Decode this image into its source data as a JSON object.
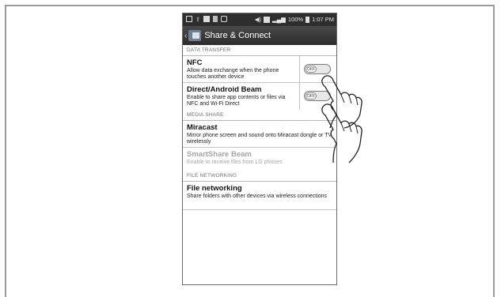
{
  "status_bar": {
    "battery": "100%",
    "time": "1:07 PM",
    "icons": [
      "image-icon",
      "upload-icon",
      "bag-icon",
      "sd-icon",
      "screen-icon",
      "volume-icon",
      "sim-icon",
      "signal-icon",
      "battery-icon"
    ]
  },
  "title_bar": {
    "title": "Share & Connect",
    "back_icon": "chevron-left-icon",
    "app_icon": "share-connect-icon"
  },
  "sections": {
    "data_transfer": "DATA TRANSFER",
    "media_share": "MEDIA SHARE",
    "file_networking": "FILE NETWORKING"
  },
  "items": {
    "nfc": {
      "title": "NFC",
      "desc": "Allow data exchange when the phone touches another device",
      "toggle": "OFF"
    },
    "direct_beam": {
      "title": "Direct/Android Beam",
      "desc": "Enable to share app contents or files via NFC and Wi-Fi Direct",
      "toggle": "OFF"
    },
    "miracast": {
      "title": "Miracast",
      "desc": "Mirror phone screen and sound onto Miracast dongle or TV wirelessly"
    },
    "smartshare": {
      "title": "SmartShare Beam",
      "desc": "Enable to receive files from LG phones"
    },
    "file_networking": {
      "title": "File networking",
      "desc": "Share folders with other devices via wireless connections"
    }
  }
}
